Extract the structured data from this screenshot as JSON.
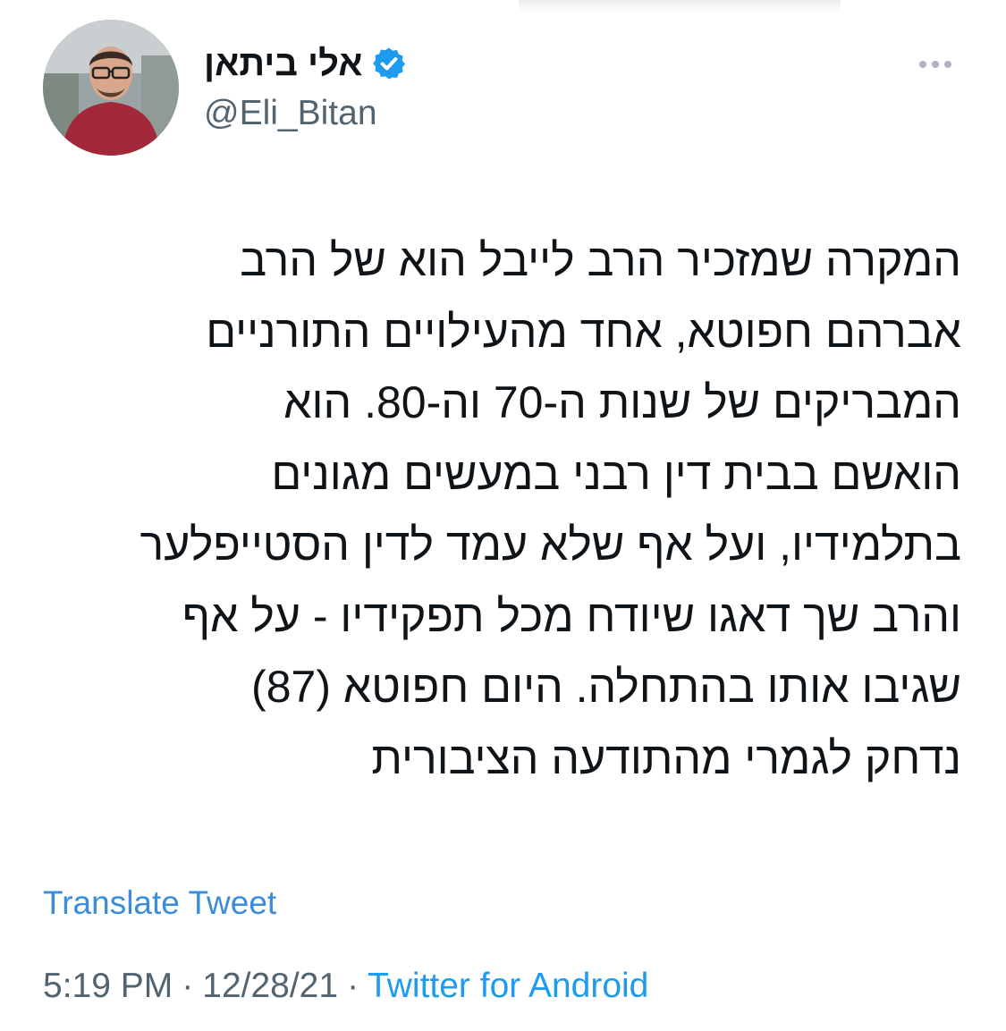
{
  "tweet": {
    "author": {
      "display_name": "אלי ביתאן",
      "handle": "@Eli_Bitan",
      "verified": true,
      "avatar_icon": "user-avatar-photo"
    },
    "more_icon": "more-options-icon",
    "text_lines": [
      "המקרה שמזכיר הרב לייבל הוא של הרב",
      "אברהם חפוטא, אחד מהעילויים התורניים",
      "המבריקים של שנות ה-70 וה-80. הוא",
      "הואשם בבית דין רבני במעשים מגונים",
      "בתלמידיו, ועל אף שלא עמד לדין הסטייפלער",
      "והרב שך דאגו שיודח מכל תפקידיו - על אף",
      "שגיבו אותו בהתחלה. היום חפוטא (87)",
      "נדחק לגמרי מהתודעה הציבורית"
    ],
    "translate_label": "Translate Tweet",
    "time": "5:19 PM",
    "separator": "·",
    "date": "12/28/21",
    "source": "Twitter for Android",
    "colors": {
      "link": "#1d9bf0",
      "secondary_text": "#536471",
      "primary_text": "#0f1419"
    }
  }
}
